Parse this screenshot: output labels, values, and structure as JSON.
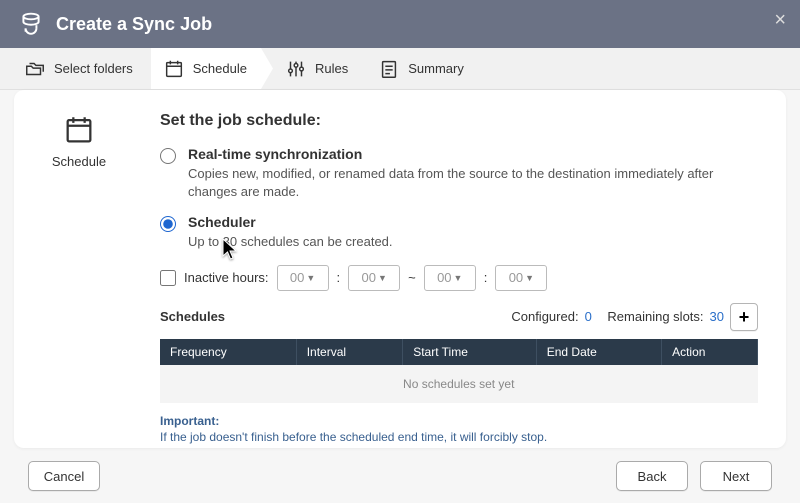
{
  "header": {
    "title": "Create a Sync Job"
  },
  "wizard": {
    "steps": [
      {
        "label": "Select folders"
      },
      {
        "label": "Schedule"
      },
      {
        "label": "Rules"
      },
      {
        "label": "Summary"
      }
    ]
  },
  "side": {
    "label": "Schedule"
  },
  "heading": "Set the job schedule:",
  "options": {
    "realtime": {
      "title": "Real-time synchronization",
      "desc": "Copies new, modified, or renamed data from the source to the destination immediately after changes are made."
    },
    "scheduler": {
      "title": "Scheduler",
      "desc": "Up to 30 schedules can be created."
    }
  },
  "inactive": {
    "label": "Inactive hours:",
    "hh1": "00",
    "mm1": "00",
    "hh2": "00",
    "mm2": "00",
    "sep": "~",
    "colon": ":"
  },
  "schedules": {
    "title": "Schedules",
    "configured_label": "Configured:",
    "configured_value": "0",
    "remaining_label": "Remaining slots:",
    "remaining_value": "30",
    "cols": {
      "freq": "Frequency",
      "interval": "Interval",
      "start": "Start Time",
      "end": "End Date",
      "action": "Action"
    },
    "empty": "No schedules set yet"
  },
  "note": {
    "title": "Important:",
    "body": "If the job doesn't finish before the scheduled end time, it will forcibly stop."
  },
  "footer": {
    "cancel": "Cancel",
    "back": "Back",
    "next": "Next"
  }
}
